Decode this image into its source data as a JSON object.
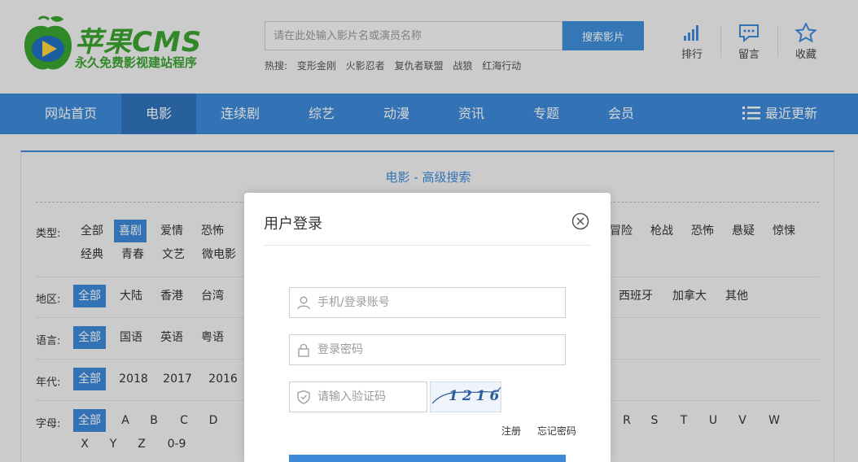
{
  "header": {
    "logo_title": "苹果CMS",
    "logo_slogan": "永久免费影视建站程序",
    "search_placeholder": "请在此处输入影片名或演员名称",
    "search_button": "搜索影片",
    "hot_label": "热搜:",
    "hot_items": [
      "变形金刚",
      "火影忍者",
      "复仇者联盟",
      "战狼",
      "红海行动"
    ],
    "links": [
      {
        "label": "排行",
        "icon": "bar-chart-icon"
      },
      {
        "label": "留言",
        "icon": "message-icon"
      },
      {
        "label": "收藏",
        "icon": "star-icon"
      }
    ]
  },
  "nav": {
    "items": [
      "网站首页",
      "电影",
      "连续剧",
      "综艺",
      "动漫",
      "资讯",
      "专题",
      "会员"
    ],
    "active": "电影",
    "recent": "最近更新"
  },
  "filter": {
    "title": "电影 - 高级搜索",
    "type_label": "类型:",
    "type_left": [
      "全部",
      "喜剧",
      "爱情",
      "恐怖"
    ],
    "type_right": [
      "冒险",
      "枪战",
      "恐怖",
      "悬疑",
      "惊悚"
    ],
    "type_row2": [
      "经典",
      "青春",
      "文艺",
      "微电影"
    ],
    "type_selected": "喜剧",
    "area_label": "地区:",
    "area_left": [
      "全部",
      "大陆",
      "香港",
      "台湾"
    ],
    "area_right": [
      "西班牙",
      "加拿大",
      "其他"
    ],
    "lang_label": "语言:",
    "lang_items": [
      "全部",
      "国语",
      "英语",
      "粤语"
    ],
    "year_label": "年代:",
    "year_items": [
      "全部",
      "2018",
      "2017",
      "2016"
    ],
    "letter_label": "字母:",
    "letter_left": [
      "全部",
      "A",
      "B",
      "C",
      "D"
    ],
    "letter_right": [
      "R",
      "S",
      "T",
      "U",
      "V",
      "W"
    ],
    "letter_row2": [
      "X",
      "Y",
      "Z",
      "0-9"
    ]
  },
  "modal": {
    "title": "用户登录",
    "account_placeholder": "手机/登录账号",
    "password_placeholder": "登录密码",
    "captcha_placeholder": "请输入验证码",
    "captcha_text": "1216",
    "register": "注册",
    "forgot": "忘记密码"
  },
  "colors": {
    "primary": "#3d8ad8",
    "nav_active": "#2f73bb",
    "logo_green": "#3aa22e"
  }
}
